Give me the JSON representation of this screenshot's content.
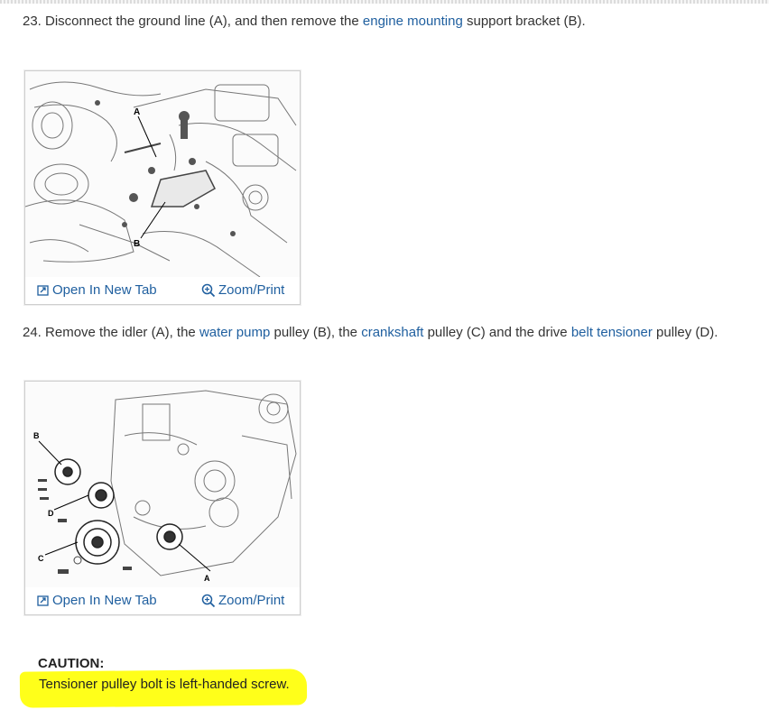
{
  "step23": {
    "prefix": "23. Disconnect the ground line (A), and then remove the ",
    "link1": "engine mounting",
    "suffix": " support bracket (B)."
  },
  "figure1": {
    "labels": {
      "a": "A",
      "b": "B"
    },
    "open_tab": "Open In New Tab",
    "zoom": "Zoom/Print"
  },
  "step24": {
    "prefix": "24. Remove the idler (A), the ",
    "link1": "water pump",
    "mid1": " pulley (B), the ",
    "link2": "crankshaft",
    "mid2": " pulley (C) and the drive ",
    "link3": "belt tensioner",
    "suffix": " pulley (D)."
  },
  "figure2": {
    "labels": {
      "a": "A",
      "b": "B",
      "c": "C",
      "d": "D"
    },
    "open_tab": "Open In New Tab",
    "zoom": "Zoom/Print"
  },
  "caution": {
    "title": "CAUTION:",
    "text": "Tensioner pulley bolt is left-handed screw",
    "trailing": "."
  },
  "colors": {
    "link": "#1f5f9f",
    "highlight": "#ffff1a",
    "text": "#333333"
  }
}
